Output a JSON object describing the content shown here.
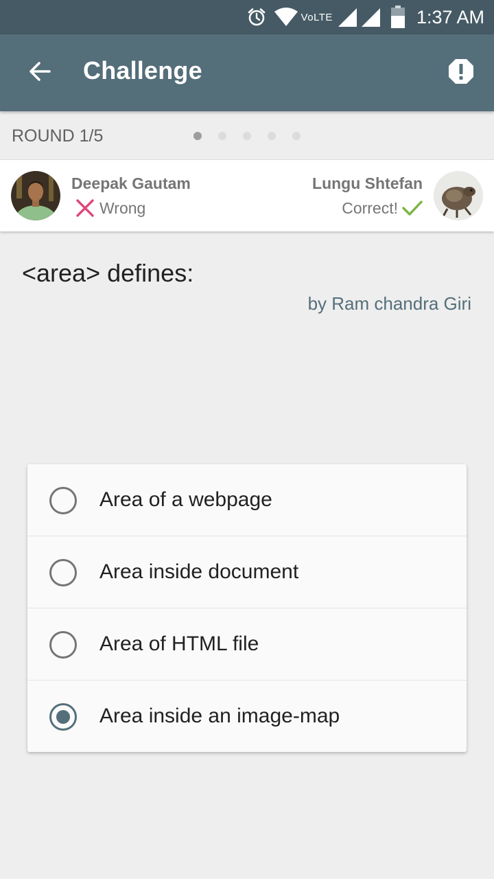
{
  "status_bar": {
    "network_label": "VoLTE",
    "time": "1:37 AM",
    "icons": [
      "alarm-icon",
      "wifi-icon",
      "signal-icon",
      "signal-icon",
      "battery-icon"
    ]
  },
  "app_bar": {
    "title": "Challenge",
    "back_icon": "arrow-back-icon",
    "report_icon": "alert-icon"
  },
  "round": {
    "label": "ROUND 1/5",
    "current": 1,
    "total": 5
  },
  "players": {
    "left": {
      "name": "Deepak Gautam",
      "result": "Wrong",
      "result_icon": "cross-icon"
    },
    "right": {
      "name": "Lungu Shtefan",
      "result": "Correct!",
      "result_icon": "check-icon"
    }
  },
  "question": {
    "text": "<area> defines:",
    "author": "by Ram chandra Giri"
  },
  "answers": [
    {
      "label": "Area of a webpage",
      "selected": false
    },
    {
      "label": "Area inside document",
      "selected": false
    },
    {
      "label": "Area of HTML file",
      "selected": false
    },
    {
      "label": "Area inside an image-map",
      "selected": true
    }
  ],
  "colors": {
    "status_bar": "#455a64",
    "app_bar": "#546e7a",
    "wrong": "#e0457b",
    "correct": "#7cb342",
    "accent": "#546e7a"
  }
}
